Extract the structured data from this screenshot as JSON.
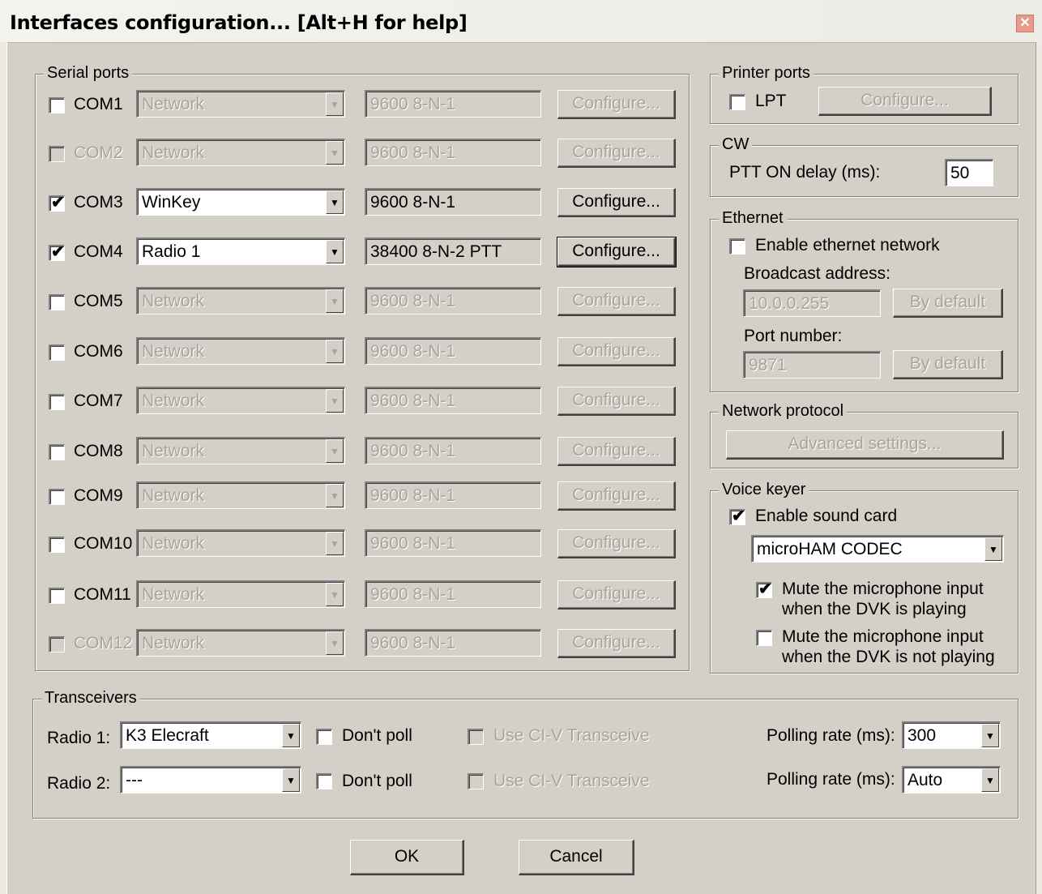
{
  "window": {
    "title": "Interfaces configuration... [Alt+H for help]",
    "close_glyph": "✕"
  },
  "serial_ports": {
    "label": "Serial ports",
    "ports": [
      {
        "name": "COM1",
        "checked": false,
        "enabled": true,
        "device": "Network",
        "settings": "9600 8-N-1",
        "configure": "Configure..."
      },
      {
        "name": "COM2",
        "checked": false,
        "enabled": false,
        "device": "Network",
        "settings": "9600 8-N-1",
        "configure": "Configure..."
      },
      {
        "name": "COM3",
        "checked": true,
        "enabled": true,
        "device": "WinKey",
        "settings": "9600 8-N-1",
        "configure": "Configure..."
      },
      {
        "name": "COM4",
        "checked": true,
        "enabled": true,
        "device": "Radio 1",
        "settings": "38400 8-N-2 PTT",
        "configure": "Configure..."
      },
      {
        "name": "COM5",
        "checked": false,
        "enabled": true,
        "device": "Network",
        "settings": "9600 8-N-1",
        "configure": "Configure..."
      },
      {
        "name": "COM6",
        "checked": false,
        "enabled": true,
        "device": "Network",
        "settings": "9600 8-N-1",
        "configure": "Configure..."
      },
      {
        "name": "COM7",
        "checked": false,
        "enabled": true,
        "device": "Network",
        "settings": "9600 8-N-1",
        "configure": "Configure..."
      },
      {
        "name": "COM8",
        "checked": false,
        "enabled": true,
        "device": "Network",
        "settings": "9600 8-N-1",
        "configure": "Configure..."
      },
      {
        "name": "COM9",
        "checked": false,
        "enabled": true,
        "device": "Network",
        "settings": "9600 8-N-1",
        "configure": "Configure..."
      },
      {
        "name": "COM10",
        "checked": false,
        "enabled": true,
        "device": "Network",
        "settings": "9600 8-N-1",
        "configure": "Configure..."
      },
      {
        "name": "COM11",
        "checked": false,
        "enabled": true,
        "device": "Network",
        "settings": "9600 8-N-1",
        "configure": "Configure..."
      },
      {
        "name": "COM12",
        "checked": false,
        "enabled": false,
        "device": "Network",
        "settings": "9600 8-N-1",
        "configure": "Configure..."
      }
    ]
  },
  "printer_ports": {
    "label": "Printer ports",
    "lpt_label": "LPT",
    "lpt_checked": false,
    "configure": "Configure..."
  },
  "cw": {
    "label": "CW",
    "ptt_label": "PTT ON delay (ms):",
    "ptt_value": "50"
  },
  "ethernet": {
    "label": "Ethernet",
    "enable_label": "Enable ethernet network",
    "enable_checked": false,
    "broadcast_label": "Broadcast address:",
    "broadcast_value": "10.0.0.255",
    "broadcast_default": "By default",
    "port_label": "Port number:",
    "port_value": "9871",
    "port_default": "By default"
  },
  "network_protocol": {
    "label": "Network protocol",
    "advanced": "Advanced settings..."
  },
  "voice_keyer": {
    "label": "Voice keyer",
    "enable_label": "Enable sound card",
    "enable_checked": true,
    "device": "microHAM CODEC",
    "mute_playing_line1": "Mute the microphone input",
    "mute_playing_line2": "when the DVK is playing",
    "mute_playing_checked": true,
    "mute_not_playing_line1": "Mute the microphone input",
    "mute_not_playing_line2": "when the DVK is not playing",
    "mute_not_playing_checked": false
  },
  "transceivers": {
    "label": "Transceivers",
    "radios": [
      {
        "label": "Radio 1:",
        "model": "K3 Elecraft",
        "dont_poll": "Don't poll",
        "civ": "Use CI-V Transceive",
        "polling_label": "Polling rate (ms):",
        "polling": "300"
      },
      {
        "label": "Radio 2:",
        "model": "---",
        "dont_poll": "Don't poll",
        "civ": "Use CI-V Transceive",
        "polling_label": "Polling rate (ms):",
        "polling": "Auto"
      }
    ]
  },
  "buttons": {
    "ok": "OK",
    "cancel": "Cancel"
  },
  "glyphs": {
    "check": "✔",
    "arrow": "▼"
  }
}
